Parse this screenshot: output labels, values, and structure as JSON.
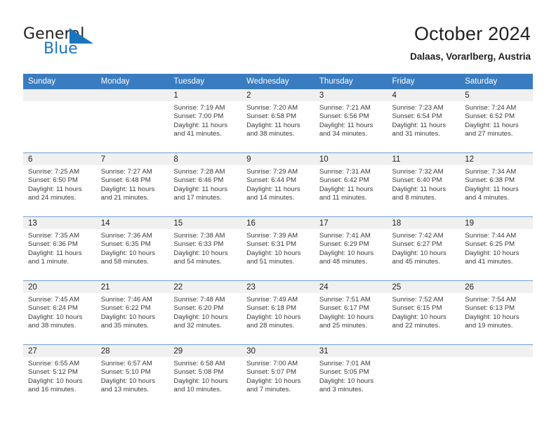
{
  "brand": {
    "name_top": "General",
    "name_bottom": "Blue",
    "triangle_icon": "blue-triangle-logo-mark",
    "color_dark": "#231f20",
    "color_blue": "#1b75bb"
  },
  "header": {
    "title": "October 2024",
    "subtitle": "Dalaas, Vorarlberg, Austria"
  },
  "theme": {
    "header_row_blue": "#3a7cc0",
    "row_divider_blue": "#6f9fd0",
    "date_band_gray": "#f0f0f0",
    "body_text": "#3b3b3b"
  },
  "calendar": {
    "weekday_headers": [
      "Sunday",
      "Monday",
      "Tuesday",
      "Wednesday",
      "Thursday",
      "Friday",
      "Saturday"
    ],
    "weeks": [
      [
        {
          "day": "",
          "lines": []
        },
        {
          "day": "",
          "lines": []
        },
        {
          "day": "1",
          "lines": [
            "Sunrise: 7:19 AM",
            "Sunset: 7:00 PM",
            "Daylight: 11 hours",
            "and 41 minutes."
          ]
        },
        {
          "day": "2",
          "lines": [
            "Sunrise: 7:20 AM",
            "Sunset: 6:58 PM",
            "Daylight: 11 hours",
            "and 38 minutes."
          ]
        },
        {
          "day": "3",
          "lines": [
            "Sunrise: 7:21 AM",
            "Sunset: 6:56 PM",
            "Daylight: 11 hours",
            "and 34 minutes."
          ]
        },
        {
          "day": "4",
          "lines": [
            "Sunrise: 7:23 AM",
            "Sunset: 6:54 PM",
            "Daylight: 11 hours",
            "and 31 minutes."
          ]
        },
        {
          "day": "5",
          "lines": [
            "Sunrise: 7:24 AM",
            "Sunset: 6:52 PM",
            "Daylight: 11 hours",
            "and 27 minutes."
          ]
        }
      ],
      [
        {
          "day": "6",
          "lines": [
            "Sunrise: 7:25 AM",
            "Sunset: 6:50 PM",
            "Daylight: 11 hours",
            "and 24 minutes."
          ]
        },
        {
          "day": "7",
          "lines": [
            "Sunrise: 7:27 AM",
            "Sunset: 6:48 PM",
            "Daylight: 11 hours",
            "and 21 minutes."
          ]
        },
        {
          "day": "8",
          "lines": [
            "Sunrise: 7:28 AM",
            "Sunset: 6:46 PM",
            "Daylight: 11 hours",
            "and 17 minutes."
          ]
        },
        {
          "day": "9",
          "lines": [
            "Sunrise: 7:29 AM",
            "Sunset: 6:44 PM",
            "Daylight: 11 hours",
            "and 14 minutes."
          ]
        },
        {
          "day": "10",
          "lines": [
            "Sunrise: 7:31 AM",
            "Sunset: 6:42 PM",
            "Daylight: 11 hours",
            "and 11 minutes."
          ]
        },
        {
          "day": "11",
          "lines": [
            "Sunrise: 7:32 AM",
            "Sunset: 6:40 PM",
            "Daylight: 11 hours",
            "and 8 minutes."
          ]
        },
        {
          "day": "12",
          "lines": [
            "Sunrise: 7:34 AM",
            "Sunset: 6:38 PM",
            "Daylight: 11 hours",
            "and 4 minutes."
          ]
        }
      ],
      [
        {
          "day": "13",
          "lines": [
            "Sunrise: 7:35 AM",
            "Sunset: 6:36 PM",
            "Daylight: 11 hours",
            "and 1 minute."
          ]
        },
        {
          "day": "14",
          "lines": [
            "Sunrise: 7:36 AM",
            "Sunset: 6:35 PM",
            "Daylight: 10 hours",
            "and 58 minutes."
          ]
        },
        {
          "day": "15",
          "lines": [
            "Sunrise: 7:38 AM",
            "Sunset: 6:33 PM",
            "Daylight: 10 hours",
            "and 54 minutes."
          ]
        },
        {
          "day": "16",
          "lines": [
            "Sunrise: 7:39 AM",
            "Sunset: 6:31 PM",
            "Daylight: 10 hours",
            "and 51 minutes."
          ]
        },
        {
          "day": "17",
          "lines": [
            "Sunrise: 7:41 AM",
            "Sunset: 6:29 PM",
            "Daylight: 10 hours",
            "and 48 minutes."
          ]
        },
        {
          "day": "18",
          "lines": [
            "Sunrise: 7:42 AM",
            "Sunset: 6:27 PM",
            "Daylight: 10 hours",
            "and 45 minutes."
          ]
        },
        {
          "day": "19",
          "lines": [
            "Sunrise: 7:44 AM",
            "Sunset: 6:25 PM",
            "Daylight: 10 hours",
            "and 41 minutes."
          ]
        }
      ],
      [
        {
          "day": "20",
          "lines": [
            "Sunrise: 7:45 AM",
            "Sunset: 6:24 PM",
            "Daylight: 10 hours",
            "and 38 minutes."
          ]
        },
        {
          "day": "21",
          "lines": [
            "Sunrise: 7:46 AM",
            "Sunset: 6:22 PM",
            "Daylight: 10 hours",
            "and 35 minutes."
          ]
        },
        {
          "day": "22",
          "lines": [
            "Sunrise: 7:48 AM",
            "Sunset: 6:20 PM",
            "Daylight: 10 hours",
            "and 32 minutes."
          ]
        },
        {
          "day": "23",
          "lines": [
            "Sunrise: 7:49 AM",
            "Sunset: 6:18 PM",
            "Daylight: 10 hours",
            "and 28 minutes."
          ]
        },
        {
          "day": "24",
          "lines": [
            "Sunrise: 7:51 AM",
            "Sunset: 6:17 PM",
            "Daylight: 10 hours",
            "and 25 minutes."
          ]
        },
        {
          "day": "25",
          "lines": [
            "Sunrise: 7:52 AM",
            "Sunset: 6:15 PM",
            "Daylight: 10 hours",
            "and 22 minutes."
          ]
        },
        {
          "day": "26",
          "lines": [
            "Sunrise: 7:54 AM",
            "Sunset: 6:13 PM",
            "Daylight: 10 hours",
            "and 19 minutes."
          ]
        }
      ],
      [
        {
          "day": "27",
          "lines": [
            "Sunrise: 6:55 AM",
            "Sunset: 5:12 PM",
            "Daylight: 10 hours",
            "and 16 minutes."
          ]
        },
        {
          "day": "28",
          "lines": [
            "Sunrise: 6:57 AM",
            "Sunset: 5:10 PM",
            "Daylight: 10 hours",
            "and 13 minutes."
          ]
        },
        {
          "day": "29",
          "lines": [
            "Sunrise: 6:58 AM",
            "Sunset: 5:08 PM",
            "Daylight: 10 hours",
            "and 10 minutes."
          ]
        },
        {
          "day": "30",
          "lines": [
            "Sunrise: 7:00 AM",
            "Sunset: 5:07 PM",
            "Daylight: 10 hours",
            "and 7 minutes."
          ]
        },
        {
          "day": "31",
          "lines": [
            "Sunrise: 7:01 AM",
            "Sunset: 5:05 PM",
            "Daylight: 10 hours",
            "and 3 minutes."
          ]
        },
        {
          "day": "",
          "lines": []
        },
        {
          "day": "",
          "lines": []
        }
      ]
    ]
  }
}
